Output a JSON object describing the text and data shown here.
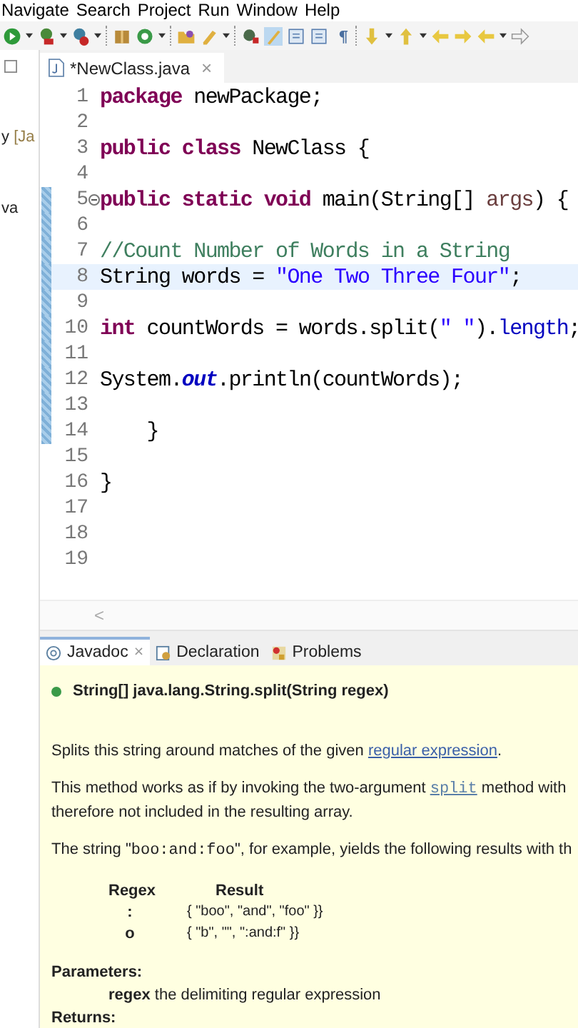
{
  "menu": [
    "Navigate",
    "Search",
    "Project",
    "Run",
    "Window",
    "Help"
  ],
  "left_strip": [
    {
      "text": "y ",
      "tag": "[Ja"
    },
    {
      "text": "va"
    }
  ],
  "editor_tab": {
    "title": "*NewClass.java",
    "close": "×"
  },
  "code_lines": [
    {
      "number": "1",
      "changed": false,
      "current": false,
      "foldable": false,
      "tokens": [
        {
          "kind": "keyword",
          "text": "package"
        },
        {
          "kind": "plain",
          "text": " newPackage;"
        }
      ]
    },
    {
      "number": "2",
      "changed": false,
      "current": false,
      "foldable": false
    },
    {
      "number": "3",
      "changed": false,
      "current": false,
      "foldable": false,
      "tokens": [
        {
          "kind": "keyword",
          "text": "public class"
        },
        {
          "kind": "plain",
          "text": " NewClass {"
        }
      ]
    },
    {
      "number": "4",
      "changed": false,
      "current": false,
      "foldable": false
    },
    {
      "number": "5",
      "changed": true,
      "current": false,
      "foldable": true,
      "tokens": [
        {
          "kind": "keyword",
          "text": "public static void"
        },
        {
          "kind": "plain",
          "text": " main(String[] "
        },
        {
          "kind": "param",
          "text": "args"
        },
        {
          "kind": "plain",
          "text": ") {"
        }
      ]
    },
    {
      "number": "6",
      "changed": true,
      "current": false,
      "foldable": false
    },
    {
      "number": "7",
      "changed": true,
      "current": false,
      "foldable": false,
      "tokens": [
        {
          "kind": "comment",
          "text": "//Count Number of Words in a String"
        }
      ]
    },
    {
      "number": "8",
      "changed": true,
      "current": true,
      "foldable": false,
      "tokens": [
        {
          "kind": "plain",
          "text": "String words = "
        },
        {
          "kind": "string",
          "text": "\"One Two Three Four\""
        },
        {
          "kind": "plain",
          "text": ";"
        }
      ]
    },
    {
      "number": "9",
      "changed": true,
      "current": false,
      "foldable": false
    },
    {
      "number": "10",
      "changed": true,
      "current": false,
      "foldable": false,
      "tokens": [
        {
          "kind": "keyword",
          "text": "int"
        },
        {
          "kind": "plain",
          "text": " countWords = words.split("
        },
        {
          "kind": "string",
          "text": "\" \""
        },
        {
          "kind": "plain",
          "text": ")."
        },
        {
          "kind": "field",
          "text": "length"
        },
        {
          "kind": "plain",
          "text": ";"
        }
      ]
    },
    {
      "number": "11",
      "changed": true,
      "current": false,
      "foldable": false
    },
    {
      "number": "12",
      "changed": true,
      "current": false,
      "foldable": false,
      "tokens": [
        {
          "kind": "plain",
          "text": "System."
        },
        {
          "kind": "static",
          "text": "out"
        },
        {
          "kind": "plain",
          "text": ".println(countWords);"
        }
      ]
    },
    {
      "number": "13",
      "changed": true,
      "current": false,
      "foldable": false
    },
    {
      "number": "14",
      "changed": true,
      "current": false,
      "foldable": false,
      "tokens": [
        {
          "kind": "plain",
          "text": "    }"
        }
      ]
    },
    {
      "number": "15",
      "changed": false,
      "current": false,
      "foldable": false
    },
    {
      "number": "16",
      "changed": false,
      "current": false,
      "foldable": false,
      "tokens": [
        {
          "kind": "plain",
          "text": "}"
        }
      ]
    },
    {
      "number": "17",
      "changed": false,
      "current": false,
      "foldable": false
    },
    {
      "number": "18",
      "changed": false,
      "current": false,
      "foldable": false
    },
    {
      "number": "19",
      "changed": false,
      "current": false,
      "foldable": false
    }
  ],
  "hscroll": {
    "arrow": "<"
  },
  "bottom_tabs": [
    {
      "label": "Javadoc",
      "selected": true,
      "close": "×"
    },
    {
      "label": "Declaration",
      "selected": false
    },
    {
      "label": "Problems",
      "selected": false
    }
  ],
  "javadoc": {
    "signature": "String[] java.lang.String.split(String regex)",
    "paragraphs": [
      {
        "lines": [
          [
            {
              "kind": "text",
              "text": "Splits this string around matches of the given "
            },
            {
              "kind": "link",
              "text": "regular expression"
            },
            {
              "kind": "text",
              "text": "."
            }
          ]
        ]
      },
      {
        "lines": [
          [
            {
              "kind": "text",
              "text": "This method works as if by invoking the two-argument "
            },
            {
              "kind": "codelink",
              "text": "split"
            },
            {
              "kind": "text",
              "text": " method with"
            }
          ],
          [
            {
              "kind": "text",
              "text": "therefore not included in the resulting array."
            }
          ]
        ]
      },
      {
        "lines": [
          [
            {
              "kind": "text",
              "text": "The string \""
            },
            {
              "kind": "code",
              "text": "boo:and:foo"
            },
            {
              "kind": "text",
              "text": "\", for example, yields the following results with th"
            }
          ]
        ]
      }
    ],
    "table": {
      "columns": [
        "Regex",
        "Result"
      ],
      "rows": [
        [
          ":",
          "{ \"boo\", \"and\", \"foo\" }}"
        ],
        [
          "o",
          "{ \"b\", \"\", \":and:f\" }}"
        ]
      ]
    },
    "parameters_label": "Parameters:",
    "parameter": "**regex** the delimiting regular expression",
    "returns_label": "Returns:"
  }
}
